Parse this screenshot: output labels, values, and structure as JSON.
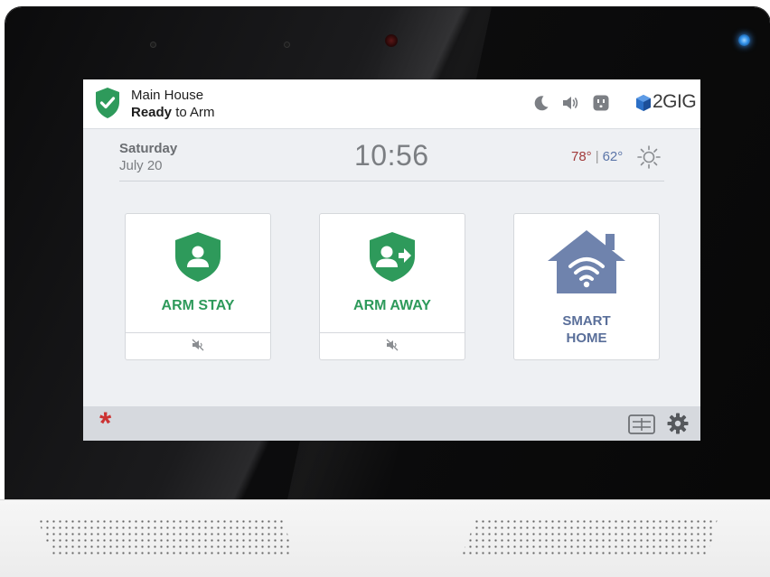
{
  "status": {
    "location_name": "Main House",
    "arm_state_bold": "Ready",
    "arm_state_rest": " to Arm",
    "icons": [
      "shield-check-icon",
      "moon-icon",
      "speaker-icon",
      "outlet-icon"
    ],
    "brand": "2GIG"
  },
  "datetime": {
    "day": "Saturday",
    "date": "July 20",
    "time": "10:56"
  },
  "weather": {
    "high": "78°",
    "separator": "|",
    "low": "62°",
    "icon": "sun-icon"
  },
  "tiles": [
    {
      "label": "ARM STAY",
      "icon": "shield-user-icon",
      "sub_icon": "mute-icon"
    },
    {
      "label": "ARM AWAY",
      "icon": "shield-user-arrow-icon",
      "sub_icon": "mute-icon"
    },
    {
      "label_line1": "SMART",
      "label_line2": "HOME",
      "icon": "wifi-house-icon"
    }
  ],
  "bottom": {
    "emergency": "*",
    "icons": [
      "keypad-icon",
      "gear-icon"
    ]
  },
  "colors": {
    "green": "#2e9a5b",
    "smart_blue": "#5a6f9a",
    "temp_high": "#a13a3a",
    "temp_low": "#5b75a8",
    "emergency_red": "#cc3333"
  }
}
